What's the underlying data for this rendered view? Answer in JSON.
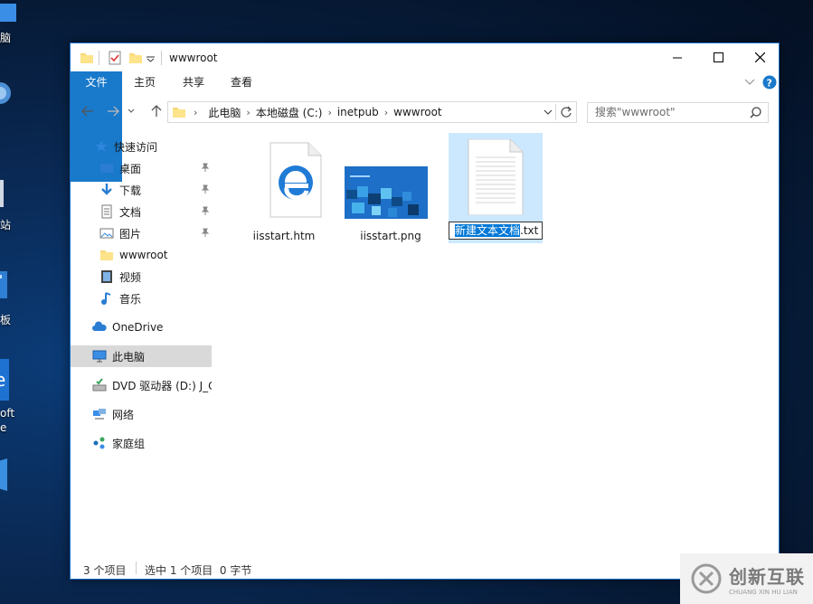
{
  "desktop": {
    "labels": [
      "脑",
      "站",
      "板",
      "oft",
      "e"
    ]
  },
  "window": {
    "title": "wwwroot",
    "controls": {
      "minimize": "minimize",
      "maximize": "maximize",
      "close": "close"
    }
  },
  "ribbon": {
    "tabs": [
      "文件",
      "主页",
      "共享",
      "查看"
    ]
  },
  "address": {
    "crumbs": [
      "此电脑",
      "本地磁盘 (C:)",
      "inetpub",
      "wwwroot"
    ]
  },
  "search": {
    "placeholder": "搜索\"wwwroot\""
  },
  "nav": {
    "quick_access": "快速访问",
    "items": [
      "桌面",
      "下载",
      "文档",
      "图片",
      "wwwroot",
      "视频",
      "音乐"
    ],
    "onedrive": "OneDrive",
    "this_pc": "此电脑",
    "dvd": "DVD 驱动器 (D:) J_C",
    "network": "网络",
    "homegroup": "家庭组"
  },
  "files": [
    {
      "name": "iisstart.htm",
      "icon": "edge-icon"
    },
    {
      "name": "iisstart.png",
      "icon": "image-thumbnail"
    },
    {
      "name_selected": "新建文本文档",
      "name_ext": ".txt",
      "icon": "text-file-icon"
    }
  ],
  "status": {
    "count": "3 个项目",
    "selection": "选中 1 个项目  0 字节"
  },
  "watermark": {
    "brand": "创新互联",
    "sub": "CHUANG XIN HU LIAN"
  }
}
